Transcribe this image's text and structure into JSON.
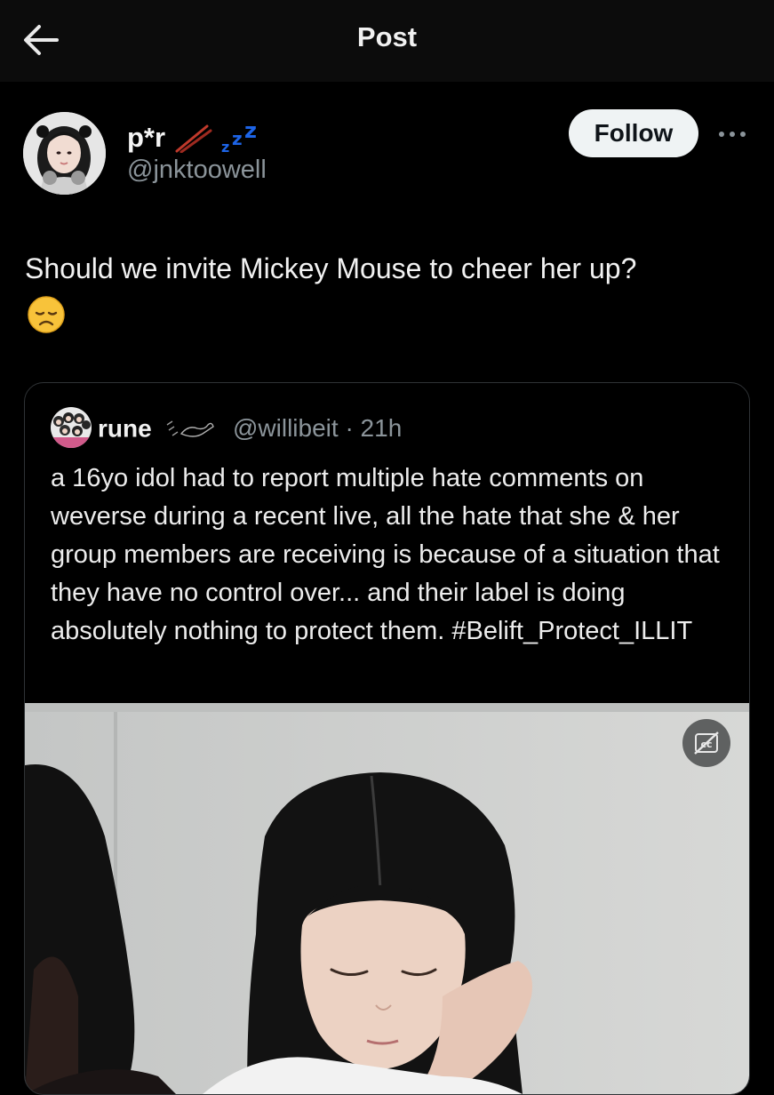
{
  "header": {
    "title": "Post",
    "back_icon": "arrow-left-icon"
  },
  "author": {
    "display_name": "p*r",
    "handle": "@jnktoowell",
    "follow_label": "Follow",
    "more_icon": "more-horizontal-icon",
    "decor_icons": [
      "chopsticks-icon",
      "sleep-zzz-icon"
    ]
  },
  "post": {
    "text": "Should we invite Mickey Mouse to cheer her up?",
    "emoji_icon": "disappointed-face-icon"
  },
  "quote": {
    "display_name": "rune",
    "handle_time": "@willibeit · 21h",
    "text": "a 16yo idol had to report multiple hate comments on weverse during a recent live, all the hate that she & her group members are receiving is because of a situation that they have no control over... and their label is doing absolutely nothing to protect them. #Belift_Protect_ILLIT",
    "media_icon": "closed-captions-off-icon"
  },
  "colors": {
    "background": "#000000",
    "header_bg": "#0c0c0c",
    "text_primary": "#e7e9ea",
    "text_secondary": "#8b949a",
    "follow_bg": "#eff3f4",
    "border": "#2f3336",
    "zzz_blue": "#1d64e6"
  }
}
